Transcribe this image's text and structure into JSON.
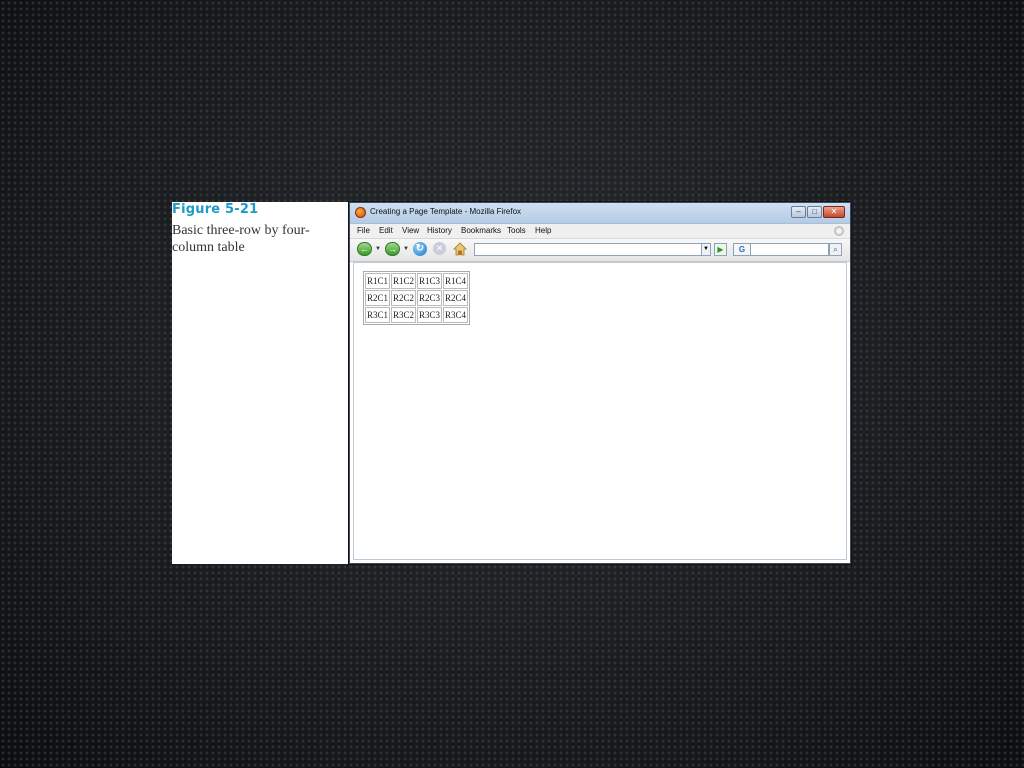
{
  "figure": {
    "label": "Figure 5-21",
    "caption": "Basic three-row by four-column table"
  },
  "window": {
    "title": "Creating a Page Template - Mozilla Firefox",
    "icon": "firefox-icon",
    "controls": {
      "minimize": "–",
      "maximize": "□",
      "close": "✕"
    }
  },
  "menu": {
    "items": [
      "File",
      "Edit",
      "View",
      "History",
      "Bookmarks",
      "Tools",
      "Help"
    ]
  },
  "navbar": {
    "back_glyph": "←",
    "forward_glyph": "→",
    "reload_glyph": "↻",
    "stop_glyph": "✕",
    "dropdown_glyph": "▼",
    "go_glyph": "▶",
    "url_value": "",
    "search_value": "",
    "search_engine_glyph": "G",
    "search_glyph": "⌕",
    "colors": {
      "go": "#2e9a22",
      "reload": "#1a76c8",
      "back": "#3b9a2a"
    }
  },
  "table": {
    "rows": [
      [
        "R1C1",
        "R1C2",
        "R1C3",
        "R1C4"
      ],
      [
        "R2C1",
        "R2C2",
        "R2C3",
        "R2C4"
      ],
      [
        "R3C1",
        "R3C2",
        "R3C3",
        "R3C4"
      ]
    ]
  }
}
